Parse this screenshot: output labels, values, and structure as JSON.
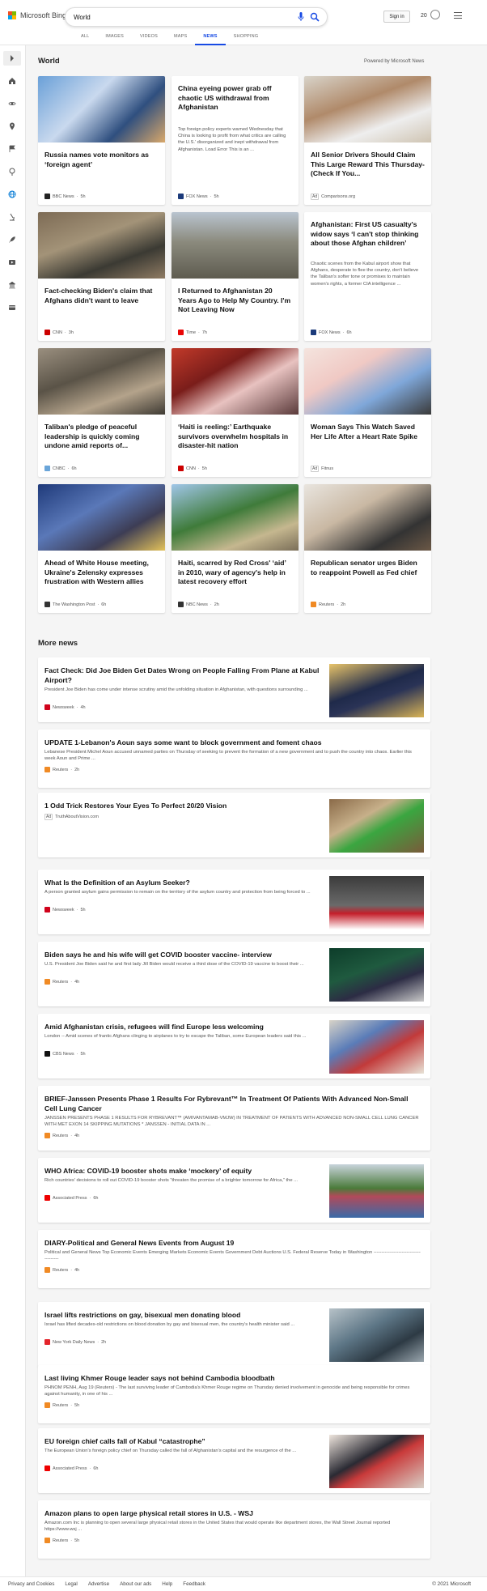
{
  "header": {
    "brand": "Microsoft Bing",
    "search_value": "World",
    "signin_label": "Sign in",
    "rewards_count": "20",
    "brand_colors": [
      "#f25022",
      "#7fba00",
      "#00a4ef",
      "#ffb900"
    ],
    "accent": "#174ae4"
  },
  "nav_tabs": [
    "ALL",
    "IMAGES",
    "VIDEOS",
    "MAPS",
    "NEWS",
    "SHOPPING"
  ],
  "active_tab": "NEWS",
  "world": {
    "heading": "World",
    "powered_by": "Powered by Microsoft News"
  },
  "cards": [
    {
      "title": "Russia names vote monitors as ‘foreign agent’",
      "snippet": "",
      "source": "BBC News",
      "time": "5h",
      "ad": false,
      "icon": "bbc-icon"
    },
    {
      "title": "China eyeing power grab off chaotic US withdrawal from Afghanistan",
      "snippet": "Top foreign policy experts warned Wednesday that China is looking to profit from what critics are calling the U.S.’ disorganized and inept withdrawal from Afghanistan. Load Error This is an ...",
      "source": "FOX News",
      "time": "5h",
      "ad": false,
      "icon": "fox-icon"
    },
    {
      "title": "All Senior Drivers Should Claim This Large Reward This Thursday-(Check If You...",
      "snippet": "",
      "source": "Comparisons.org",
      "time": "",
      "ad": true,
      "icon": ""
    },
    {
      "title": "Fact-checking Biden's claim that Afghans didn't want to leave",
      "snippet": "",
      "source": "CNN",
      "time": "3h",
      "ad": false,
      "icon": "cnn-icon"
    },
    {
      "title": "I Returned to Afghanistan 20 Years Ago to Help My Country. I'm Not Leaving Now",
      "snippet": "",
      "source": "Time",
      "time": "7h",
      "ad": false,
      "icon": "time-icon"
    },
    {
      "title": "Afghanistan: First US casualty's widow says ‘I can't stop thinking about those Afghan children’",
      "snippet": "Chaotic scenes from the Kabul airport show that Afghans, desperate to flee the country, don't believe the Taliban's softer tone or promises to maintain women's rights, a former CIA intelligence ...",
      "source": "FOX News",
      "time": "6h",
      "ad": false,
      "icon": "fox-icon"
    },
    {
      "title": "Taliban's pledge of peaceful leadership is quickly coming undone amid reports of...",
      "snippet": "",
      "source": "CNBC",
      "time": "6h",
      "ad": false,
      "icon": "cnbc-icon"
    },
    {
      "title": "‘Haiti is reeling:’ Earthquake survivors overwhelm hospitals in disaster-hit nation",
      "snippet": "",
      "source": "CNN",
      "time": "5h",
      "ad": false,
      "icon": "cnn-icon"
    },
    {
      "title": "Woman Says This Watch Saved Her Life After a Heart Rate Spike",
      "snippet": "",
      "source": "Fitnus",
      "time": "",
      "ad": true,
      "icon": ""
    },
    {
      "title": "Ahead of White House meeting, Ukraine's Zelensky expresses frustration with Western allies",
      "snippet": "",
      "source": "The Washington Post",
      "time": "6h",
      "ad": false,
      "icon": "wapo-icon"
    },
    {
      "title": "Haiti, scarred by Red Cross' ‘aid’ in 2010, wary of agency's help in latest recovery effort",
      "snippet": "",
      "source": "NBC News",
      "time": "2h",
      "ad": false,
      "icon": "nbc-icon"
    },
    {
      "title": "Republican senator urges Biden to reappoint Powell as Fed chief",
      "snippet": "",
      "source": "Reuters",
      "time": "2h",
      "ad": false,
      "icon": "reuters-icon"
    }
  ],
  "more_news": {
    "heading": "More news",
    "items": [
      {
        "title": "Fact Check: Did Joe Biden Get Dates Wrong on People Falling From Plane at Kabul Airport?",
        "snippet": "President Joe Biden has come under intense scrutiny amid the unfolding situation in Afghanistan, with questions surrounding ...",
        "source": "Newsweek",
        "time": "4h",
        "ad": false
      },
      {
        "title": "UPDATE 1-Lebanon's Aoun says some want to block government and foment chaos",
        "snippet": "Lebanese President Michel Aoun accused unnamed parties on Thursday of seeking to prevent the formation of a new government and to push the country into chaos. Earlier this week Aoun and Prime ...",
        "source": "Reuters",
        "time": "2h",
        "ad": false
      },
      {
        "title": "1 Odd Trick Restores Your Eyes To Perfect 20/20 Vision",
        "snippet": "",
        "source": "TruthAboutVision.com",
        "time": "",
        "ad": true
      },
      {
        "title": "What Is the Definition of an Asylum Seeker?",
        "snippet": "A person granted asylum gains permission to remain on the territory of the asylum country and protection from being forced to ...",
        "source": "Newsweek",
        "time": "5h",
        "ad": false
      },
      {
        "title": "Biden says he and his wife will get COVID booster vaccine- interview",
        "snippet": "U.S. President Joe Biden said he and first lady Jill Biden would receive a third dose of the COVID-19 vaccine to boost their ...",
        "source": "Reuters",
        "time": "4h",
        "ad": false
      },
      {
        "title": "Amid Afghanistan crisis, refugees will find Europe less welcoming",
        "snippet": "London -- Amid scenes of frantic Afghans clinging to airplanes to try to escape the Taliban, some European leaders said this ...",
        "source": "CBS News",
        "time": "5h",
        "ad": false
      },
      {
        "title": "BRIEF-Janssen Presents Phase 1 Results For Rybrevant™ In Treatment Of Patients With Advanced Non-Small Cell Lung Cancer",
        "snippet": "JANSSEN PRESENTS PHASE 1 RESULTS FOR RYBREVANT™ (AMIVANTAMAB-VMJW) IN TREATMENT OF PATIENTS WITH ADVANCED NON-SMALL CELL LUNG CANCER WITH MET EXON 14 SKIPPING MUTATIONS * JANSSEN - INITIAL DATA IN ...",
        "source": "Reuters",
        "time": "4h",
        "ad": false
      },
      {
        "title": "WHO Africa: COVID-19 booster shots make ‘mockery’ of equity",
        "snippet": "Rich countries' decisions to roll out COVID-19 booster shots “threaten the promise of a brighter tomorrow for Africa,” the ...",
        "source": "Associated Press",
        "time": "6h",
        "ad": false
      },
      {
        "title": "DIARY-Political and General News Events from August 19",
        "snippet": "Political and General News Top Economic Events Emerging Markets Economic Events Government Debt Auctions U.S. Federal Reserve Today in Washington ---------------------------------------",
        "source": "Reuters",
        "time": "4h",
        "ad": false
      },
      {
        "title": "Israel lifts restrictions on gay, bisexual men donating blood",
        "snippet": "Israel has lifted decades-old restrictions on blood donation by gay and bisexual men, the country's health minister said ...",
        "source": "New York Daily News",
        "time": "2h",
        "ad": false
      },
      {
        "title": "Last living Khmer Rouge leader says not behind Cambodia bloodbath",
        "snippet": "PHNOM PENH, Aug 19 (Reuters) - The last surviving leader of Cambodia's Khmer Rouge regime on Thursday denied involvement in genocide and being responsible for crimes against humanity, in one of his ...",
        "source": "Reuters",
        "time": "5h",
        "ad": false
      },
      {
        "title": "EU foreign chief calls fall of Kabul “catastrophe”",
        "snippet": "The European Union's foreign policy chief on Thursday called the fall of Afghanistan's capital and the resurgence of the ...",
        "source": "Associated Press",
        "time": "6h",
        "ad": false
      },
      {
        "title": "Amazon plans to open large physical retail stores in U.S. - WSJ",
        "snippet": "Amazon.com Inc is planning to open several large physical retail stores in the United States that would operate like department stores, the Wall Street Journal reported https://www.wsj ...",
        "source": "Reuters",
        "time": "5h",
        "ad": false
      }
    ]
  },
  "ad_label": "Ad",
  "footer": {
    "links": [
      "Privacy and Cookies",
      "Legal",
      "Advertise",
      "About our ads",
      "Help",
      "Feedback"
    ],
    "copyright": "© 2021 Microsoft"
  }
}
